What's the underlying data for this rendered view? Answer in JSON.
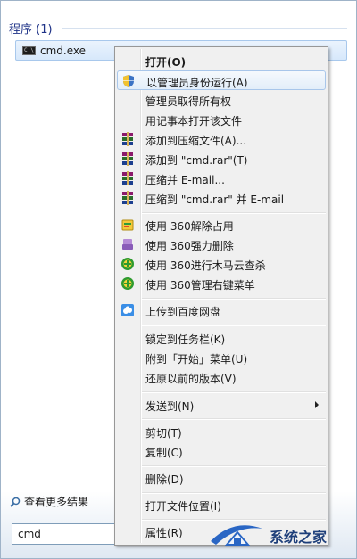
{
  "section": {
    "title": "程序 (1)"
  },
  "result": {
    "label": "cmd.exe",
    "icon": "cmd-icon"
  },
  "see_more": {
    "label": "查看更多结果",
    "icon": "search-icon"
  },
  "search": {
    "value": "cmd"
  },
  "menu": {
    "items": [
      {
        "label": "打开(O)",
        "bold": true
      },
      {
        "label": "以管理员身份运行(A)",
        "icon": "uac-shield-icon",
        "highlighted": true
      },
      {
        "label": "管理员取得所有权"
      },
      {
        "label": "用记事本打开该文件"
      },
      {
        "label": "添加到压缩文件(A)...",
        "icon": "winrar-icon"
      },
      {
        "label": "添加到 \"cmd.rar\"(T)",
        "icon": "winrar-icon"
      },
      {
        "label": "压缩并 E-mail...",
        "icon": "winrar-icon"
      },
      {
        "label": "压缩到 \"cmd.rar\" 并 E-mail",
        "icon": "winrar-icon"
      },
      {
        "label": "使用 360解除占用",
        "icon": "360-unlock-icon"
      },
      {
        "label": "使用 360强力删除",
        "icon": "360-shred-icon"
      },
      {
        "label": "使用 360进行木马云查杀",
        "icon": "360-scan-icon"
      },
      {
        "label": "使用 360管理右键菜单",
        "icon": "360-menu-icon"
      },
      {
        "label": "上传到百度网盘",
        "icon": "baidu-cloud-icon"
      },
      {
        "label": "锁定到任务栏(K)"
      },
      {
        "label": "附到「开始」菜单(U)"
      },
      {
        "label": "还原以前的版本(V)"
      },
      {
        "label": "发送到(N)",
        "submenu": true
      },
      {
        "label": "剪切(T)"
      },
      {
        "label": "复制(C)"
      },
      {
        "label": "删除(D)"
      },
      {
        "label": "打开文件位置(I)"
      },
      {
        "label": "属性(R)"
      }
    ]
  },
  "watermark": {
    "text": "系统之家"
  },
  "colors": {
    "accent": "#1e3287",
    "highlight_border": "#a8c6ea",
    "menu_bg": "#f0f0f0"
  }
}
